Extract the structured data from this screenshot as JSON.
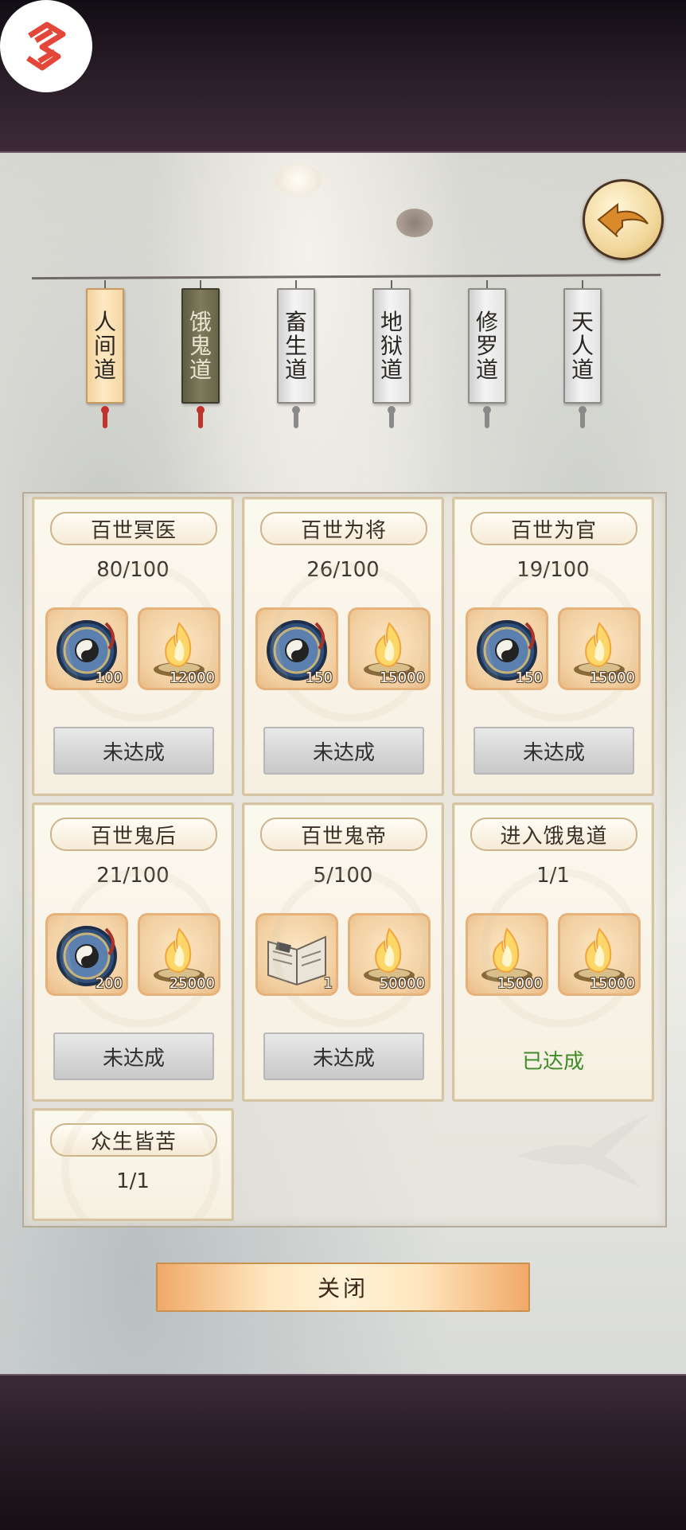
{
  "tabs": [
    {
      "label": "人间道",
      "state": "active"
    },
    {
      "label": "饿鬼道",
      "state": "selected-dark"
    },
    {
      "label": "畜生道",
      "state": "normal"
    },
    {
      "label": "地狱道",
      "state": "normal"
    },
    {
      "label": "修罗道",
      "state": "normal"
    },
    {
      "label": "天人道",
      "state": "normal"
    }
  ],
  "cards": [
    {
      "title": "百世冥医",
      "progress": "80/100",
      "rewards": [
        {
          "icon": "taiji-compass-icon",
          "qty": "100"
        },
        {
          "icon": "soul-fire-icon",
          "qty": "12000"
        }
      ],
      "button": "未达成",
      "status": ""
    },
    {
      "title": "百世为将",
      "progress": "26/100",
      "rewards": [
        {
          "icon": "taiji-compass-icon",
          "qty": "150"
        },
        {
          "icon": "soul-fire-icon",
          "qty": "15000"
        }
      ],
      "button": "未达成",
      "status": ""
    },
    {
      "title": "百世为官",
      "progress": "19/100",
      "rewards": [
        {
          "icon": "taiji-compass-icon",
          "qty": "150"
        },
        {
          "icon": "soul-fire-icon",
          "qty": "15000"
        }
      ],
      "button": "未达成",
      "status": ""
    },
    {
      "title": "百世鬼后",
      "progress": "21/100",
      "rewards": [
        {
          "icon": "taiji-compass-icon",
          "qty": "200"
        },
        {
          "icon": "soul-fire-icon",
          "qty": "25000"
        }
      ],
      "button": "未达成",
      "status": ""
    },
    {
      "title": "百世鬼帝",
      "progress": "5/100",
      "rewards": [
        {
          "icon": "scripture-book-icon",
          "qty": "1"
        },
        {
          "icon": "soul-fire-icon",
          "qty": "50000"
        }
      ],
      "button": "未达成",
      "status": ""
    },
    {
      "title": "进入饿鬼道",
      "progress": "1/1",
      "rewards": [
        {
          "icon": "soul-fire-icon",
          "qty": "15000"
        },
        {
          "icon": "soul-fire-icon",
          "qty": "15000"
        }
      ],
      "button": "",
      "status": "已达成"
    },
    {
      "title": "众生皆苦",
      "progress": "1/1",
      "rewards": [],
      "button": "",
      "status": ""
    }
  ],
  "close_label": "关闭",
  "colors": {
    "achieved": "#3e8b28",
    "tab_active": "#ffe9c4",
    "tab_dark": "#7f7c5d",
    "reward_border": "#e6b27a"
  }
}
